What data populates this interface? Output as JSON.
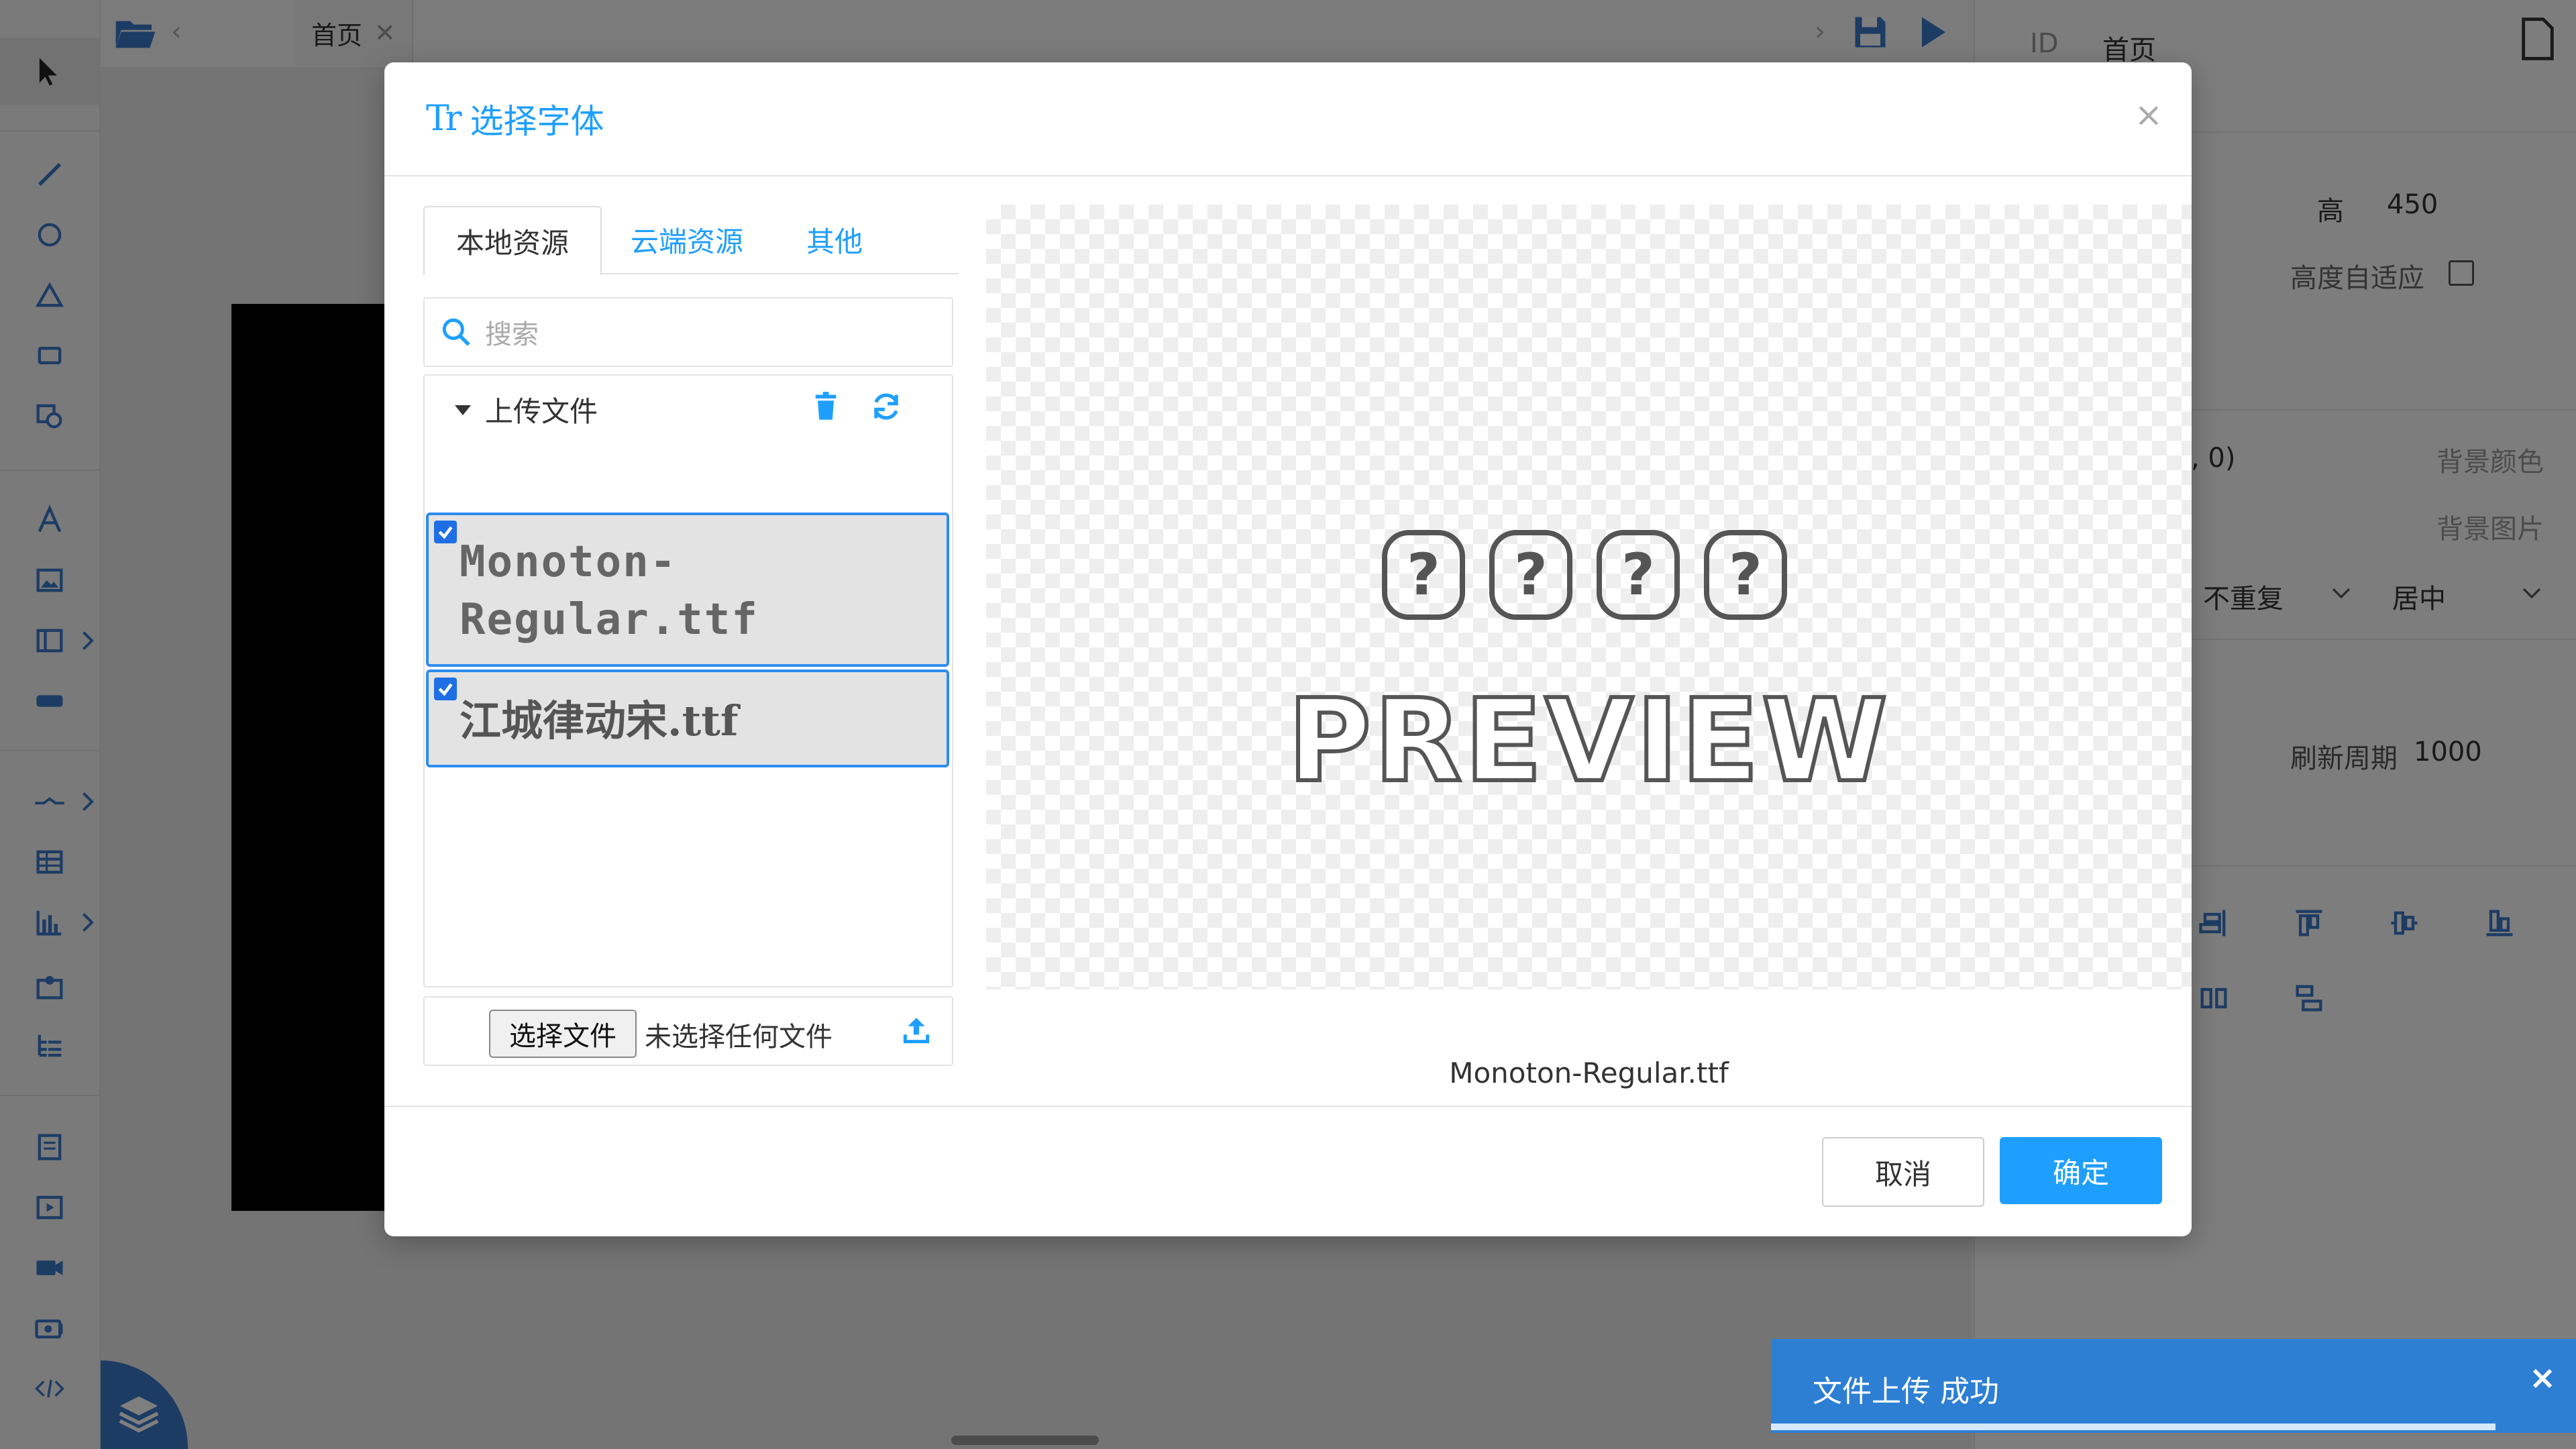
{
  "app": {
    "tab": {
      "label": "首页",
      "close": "✕"
    },
    "right_panel": {
      "id_label": "ID",
      "id_value": "首页",
      "height_label": "高",
      "height_value": "450",
      "auto_height_label": "高度自适应",
      "partial_value": ", 0)",
      "bg_color_label": "背景颜色",
      "bg_image_label": "背景图片",
      "repeat_value": "不重复",
      "position_value": "居中",
      "refresh_label": "刷新周期",
      "refresh_value": "1000"
    }
  },
  "dialog": {
    "title_icon": "Tr",
    "title": "选择字体",
    "close": "×",
    "tabs": [
      {
        "label": "本地资源",
        "active": true
      },
      {
        "label": "云端资源",
        "active": false
      },
      {
        "label": "其他",
        "active": false
      }
    ],
    "search": {
      "placeholder": "搜索"
    },
    "tree": {
      "folder_label": "上传文件",
      "files": [
        {
          "line1": "Monoton-",
          "line2": "Regular.ttf",
          "checked": true
        },
        {
          "name": "江城律动宋.ttf",
          "checked": true
        }
      ]
    },
    "upload": {
      "choose_button": "选择文件",
      "no_file": "未选择任何文件"
    },
    "preview": {
      "glyphs": [
        "?",
        "?",
        "?",
        "?"
      ],
      "word": "PREVIEW",
      "caption": "Monoton-Regular.ttf"
    },
    "footer": {
      "cancel": "取消",
      "confirm": "确定"
    }
  },
  "toast": {
    "message": "文件上传 成功",
    "close": "×"
  },
  "colors": {
    "accent": "#1e9fff",
    "toast_bg": "#2d7fd3",
    "selection_border": "#2d8cf0"
  }
}
